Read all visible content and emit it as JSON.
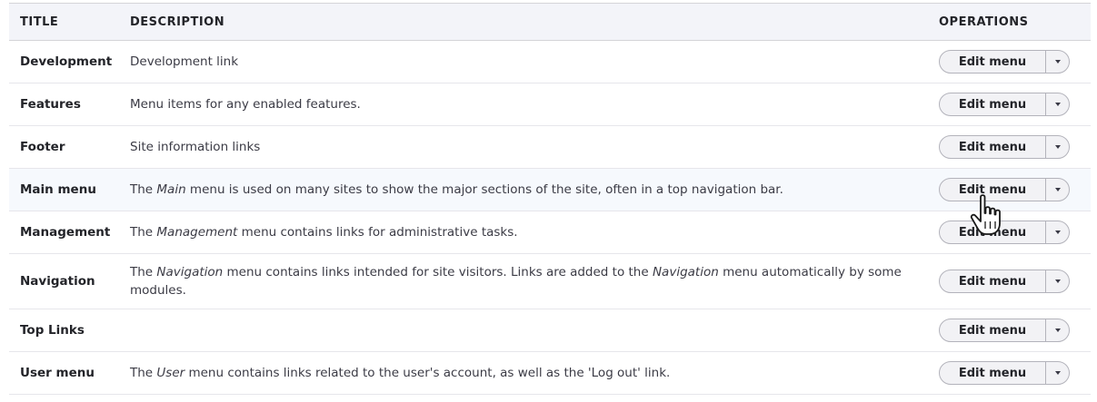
{
  "table": {
    "headers": {
      "title": "TITLE",
      "description": "DESCRIPTION",
      "operations": "OPERATIONS"
    },
    "rows": [
      {
        "title": "Development",
        "description": [
          {
            "t": "Development link"
          }
        ],
        "action": "Edit menu"
      },
      {
        "title": "Features",
        "description": [
          {
            "t": "Menu items for any enabled features."
          }
        ],
        "action": "Edit menu"
      },
      {
        "title": "Footer",
        "description": [
          {
            "t": "Site information links"
          }
        ],
        "action": "Edit menu"
      },
      {
        "title": "Main menu",
        "description": [
          {
            "t": "The "
          },
          {
            "t": "Main",
            "em": true
          },
          {
            "t": " menu is used on many sites to show the major sections of the site, often in a top navigation bar."
          }
        ],
        "action": "Edit menu",
        "hovered": true
      },
      {
        "title": "Management",
        "description": [
          {
            "t": "The "
          },
          {
            "t": "Management",
            "em": true
          },
          {
            "t": " menu contains links for administrative tasks."
          }
        ],
        "action": "Edit menu"
      },
      {
        "title": "Navigation",
        "description": [
          {
            "t": "The "
          },
          {
            "t": "Navigation",
            "em": true
          },
          {
            "t": " menu contains links intended for site visitors. Links are added to the "
          },
          {
            "t": "Navigation",
            "em": true
          },
          {
            "t": " menu automatically by some modules."
          }
        ],
        "action": "Edit menu"
      },
      {
        "title": "Top Links",
        "description": [],
        "action": "Edit menu"
      },
      {
        "title": "User menu",
        "description": [
          {
            "t": "The "
          },
          {
            "t": "User",
            "em": true
          },
          {
            "t": " menu contains links related to the user's account, as well as the 'Log out' link."
          }
        ],
        "action": "Edit menu"
      }
    ]
  },
  "icons": {
    "dropdown_toggle": "chevron-down-icon",
    "cursor": "hand-pointer-icon"
  },
  "colors": {
    "header_bg": "#f3f4f9",
    "hover_row_bg": "#f6f9fd",
    "button_bg": "#f2f2f5",
    "button_border": "#b3b3bb"
  }
}
